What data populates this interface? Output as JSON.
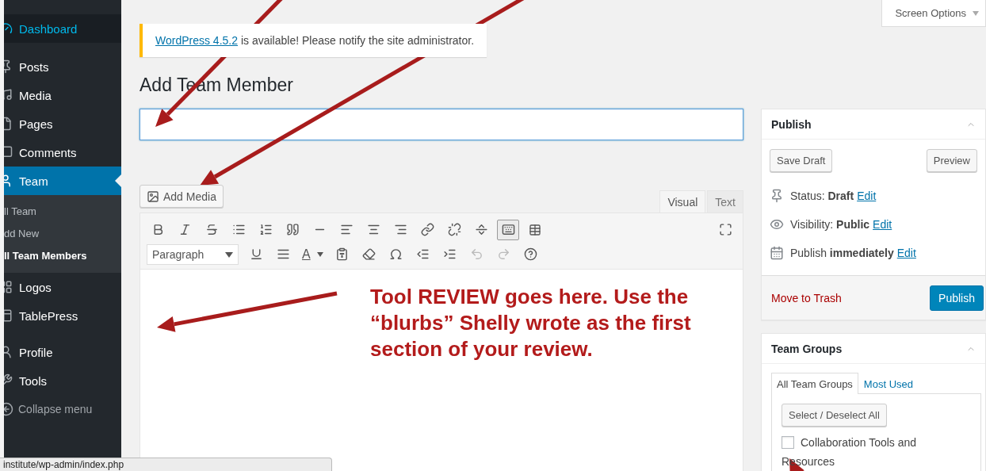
{
  "sidebar": {
    "items": [
      {
        "label": "Dashboard",
        "selected": false,
        "hovered": true
      },
      {
        "label": "Posts",
        "selected": false,
        "hovered": false
      },
      {
        "label": "Media",
        "selected": false,
        "hovered": false
      },
      {
        "label": "Pages",
        "selected": false,
        "hovered": false
      },
      {
        "label": "Comments",
        "selected": false,
        "hovered": false
      },
      {
        "label": "Team",
        "selected": true,
        "hovered": false,
        "children": [
          {
            "label": "ll Team",
            "selected": false
          },
          {
            "label": "dd New",
            "selected": false
          },
          {
            "label": "ll Team Members",
            "selected": true
          }
        ]
      },
      {
        "label": "Logos",
        "selected": false,
        "hovered": false
      },
      {
        "label": "TablePress",
        "selected": false,
        "hovered": false
      },
      {
        "label": "Profile",
        "selected": false,
        "hovered": false
      },
      {
        "label": "Tools",
        "selected": false,
        "hovered": false
      }
    ],
    "collapse": "Collapse menu"
  },
  "screen_options": "Screen Options",
  "notice": {
    "link": "WordPress 4.5.2",
    "text": " is available! Please notify the site administrator."
  },
  "title": "Add Team Member",
  "add_media": "Add Media",
  "editor_tabs": [
    {
      "label": "Visual",
      "selected": true
    },
    {
      "label": "Text",
      "selected": false
    }
  ],
  "editor": {
    "format": "Paragraph",
    "text_color_letter": "A",
    "toolbar_toggle_pressed": true
  },
  "publish_box": {
    "title": "Publish",
    "save_draft": "Save Draft",
    "preview": "Preview",
    "rows": [
      {
        "label": "Status: ",
        "value": "Draft",
        "link": "Edit"
      },
      {
        "label": "Visibility: ",
        "value": "Public",
        "link": "Edit"
      },
      {
        "label": "Publish ",
        "value": "immediately",
        "link": "Edit"
      }
    ],
    "trash": "Move to Trash",
    "publish": "Publish"
  },
  "groups_box": {
    "title": "Team Groups",
    "tabs": [
      {
        "label": "All Team Groups",
        "selected": true
      },
      {
        "label": "Most Used",
        "selected": false
      }
    ],
    "select_all": "Select / Deselect All",
    "items": [
      {
        "label": "Collaboration Tools and Resources",
        "checked": false
      }
    ]
  },
  "annotation": "Tool REVIEW goes here. Use the “blurbs” Shelly wrote as the first section of your review.",
  "status_url": "institute/wp-admin/index.php"
}
